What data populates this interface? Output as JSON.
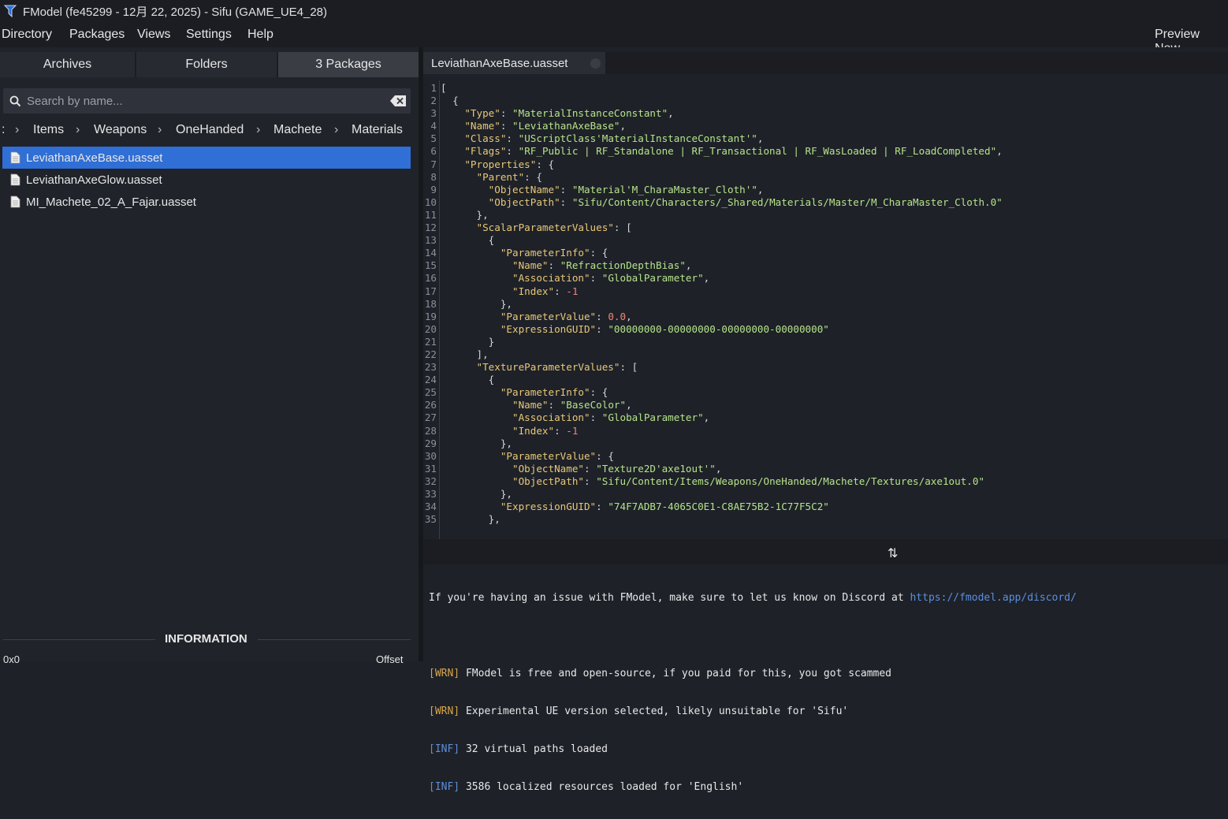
{
  "window": {
    "title": "FModel (fe45299 - 12月 22, 2025) - Sifu (GAME_UE4_28)"
  },
  "menu": {
    "items": [
      "Directory",
      "Packages",
      "Views",
      "Settings",
      "Help"
    ],
    "right": "Preview New"
  },
  "tabs": [
    "Archives",
    "Folders",
    "3 Packages"
  ],
  "search": {
    "placeholder": "Search by name..."
  },
  "breadcrumb": [
    ":",
    "Items",
    "Weapons",
    "OneHanded",
    "Machete",
    "Materials"
  ],
  "files": [
    "LeviathanAxeBase.uasset",
    "LeviathanAxeGlow.uasset",
    "MI_Machete_02_A_Fajar.uasset"
  ],
  "info": {
    "header": "INFORMATION",
    "left": "0x0",
    "right": "Offset"
  },
  "document": {
    "tab": "LeviathanAxeBase.uasset"
  },
  "code_lines": [
    "[",
    "  {",
    "    \"Type\": \"MaterialInstanceConstant\",",
    "    \"Name\": \"LeviathanAxeBase\",",
    "    \"Class\": \"UScriptClass'MaterialInstanceConstant'\",",
    "    \"Flags\": \"RF_Public | RF_Standalone | RF_Transactional | RF_WasLoaded | RF_LoadCompleted\",",
    "    \"Properties\": {",
    "      \"Parent\": {",
    "        \"ObjectName\": \"Material'M_CharaMaster_Cloth'\",",
    "        \"ObjectPath\": \"Sifu/Content/Characters/_Shared/Materials/Master/M_CharaMaster_Cloth.0\"",
    "      },",
    "      \"ScalarParameterValues\": [",
    "        {",
    "          \"ParameterInfo\": {",
    "            \"Name\": \"RefractionDepthBias\",",
    "            \"Association\": \"GlobalParameter\",",
    "            \"Index\": -1",
    "          },",
    "          \"ParameterValue\": 0.0,",
    "          \"ExpressionGUID\": \"00000000-00000000-00000000-00000000\"",
    "        }",
    "      ],",
    "      \"TextureParameterValues\": [",
    "        {",
    "          \"ParameterInfo\": {",
    "            \"Name\": \"BaseColor\",",
    "            \"Association\": \"GlobalParameter\",",
    "            \"Index\": -1",
    "          },",
    "          \"ParameterValue\": {",
    "            \"ObjectName\": \"Texture2D'axe1out'\",",
    "            \"ObjectPath\": \"Sifu/Content/Items/Weapons/OneHanded/Machete/Textures/axe1out.0\"",
    "          },",
    "          \"ExpressionGUID\": \"74F7ADB7-4065C0E1-C8AE75B2-1C77F5C2\"",
    "        },"
  ],
  "log": {
    "discord_text": "If you're having an issue with FModel, make sure to let us know on Discord at ",
    "discord_url": "https://fmodel.app/discord/",
    "entries": [
      {
        "level": "[WRN]",
        "text": " FModel is free and open-source, if you paid for this, you got scammed"
      },
      {
        "level": "[WRN]",
        "text": " Experimental UE version selected, likely unsuitable for 'Sifu'"
      },
      {
        "level": "[INF]",
        "text": " 32 virtual paths loaded"
      },
      {
        "level": "[INF]",
        "text": " 3586 localized resources loaded for 'English'"
      }
    ]
  },
  "colors": {
    "selection": "#2f6fd6",
    "key": "#e8c878",
    "string": "#b6e38a",
    "number": "#f0857a",
    "warn": "#d9a54a",
    "info": "#5d8fd6"
  }
}
